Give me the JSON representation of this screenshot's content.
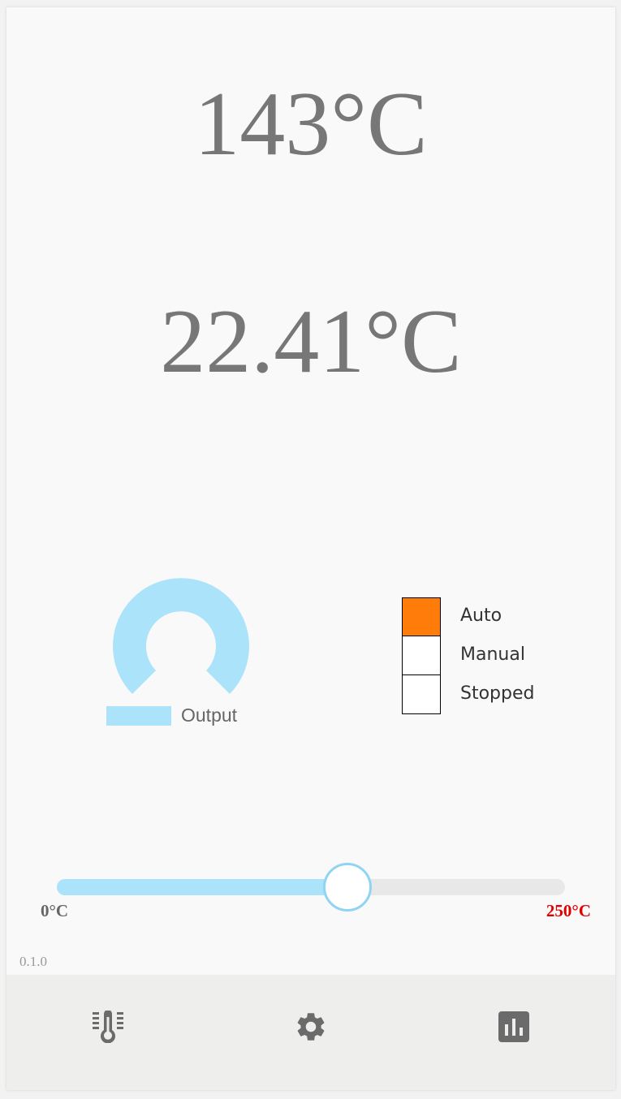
{
  "display": {
    "setpoint": "143°C",
    "current": "22.41°C"
  },
  "output_gauge": {
    "legend_label": "Output",
    "color": "#abe3fa"
  },
  "modes": {
    "items": [
      {
        "label": "Auto",
        "active": true
      },
      {
        "label": "Manual",
        "active": false
      },
      {
        "label": "Stopped",
        "active": false
      }
    ],
    "active_color": "#ff7b0a"
  },
  "setpoint_slider": {
    "min_label": "0°C",
    "max_label": "250°C",
    "min": 0,
    "max": 250,
    "value": 143,
    "fill_color": "#abe3fa",
    "max_label_color": "#e00000"
  },
  "version": "0.1.0",
  "nav": {
    "items": [
      {
        "icon": "thermometer-icon"
      },
      {
        "icon": "gear-icon"
      },
      {
        "icon": "bar-chart-icon"
      }
    ]
  }
}
